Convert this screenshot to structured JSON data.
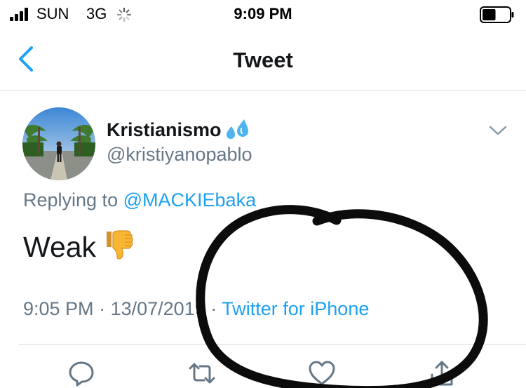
{
  "status_bar": {
    "carrier": "SUN",
    "network": "3G",
    "time": "9:09 PM",
    "signal_icon": "signal-bars-icon",
    "activity_icon": "network-activity-spinner-icon",
    "battery_icon": "battery-icon",
    "battery_level": 0.5
  },
  "nav": {
    "title": "Tweet",
    "back_icon": "chevron-left-icon"
  },
  "tweet": {
    "display_name": "Kristianismo",
    "name_emoji": "sweat-droplets-icon",
    "handle": "@kristiyanopablo",
    "replying_prefix": "Replying to",
    "reply_to": "@MACKIEbaka",
    "text": "Weak",
    "text_emoji": "thumbs-down-icon",
    "time": "9:05 PM",
    "date": "13/07/2019",
    "separator": "·",
    "source": "Twitter for iPhone"
  },
  "actions": [
    "reply-icon",
    "retweet-icon",
    "like-icon",
    "share-icon"
  ],
  "colors": {
    "link": "#1da1f2",
    "secondary_text": "#657786",
    "primary_text": "#14171a",
    "divider": "#d7dde2",
    "thumbs_emoji": "#f7b733"
  }
}
